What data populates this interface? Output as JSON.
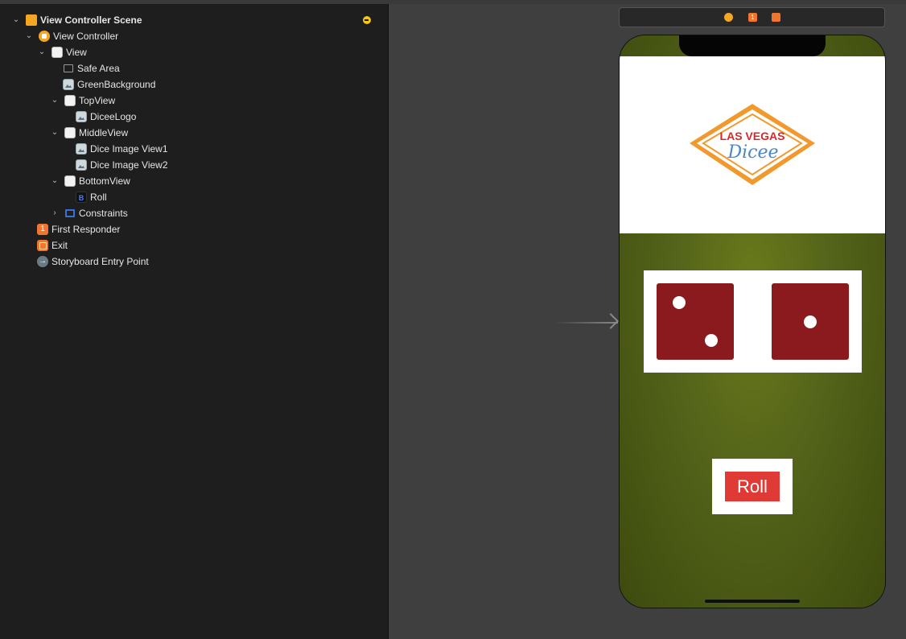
{
  "outline": {
    "items": [
      {
        "label": "View Controller Scene",
        "bold": true,
        "icon": "scene-icon",
        "disclosure": "expanded"
      },
      {
        "label": "View Controller",
        "icon": "view-controller-icon",
        "disclosure": "expanded"
      },
      {
        "label": "View",
        "icon": "view-icon",
        "disclosure": "expanded"
      },
      {
        "label": "Safe Area",
        "icon": "safe-area-icon",
        "disclosure": "none"
      },
      {
        "label": "GreenBackground",
        "icon": "image-view-icon",
        "disclosure": "none"
      },
      {
        "label": "TopView",
        "icon": "view-icon",
        "disclosure": "expanded"
      },
      {
        "label": "DiceeLogo",
        "icon": "image-view-icon",
        "disclosure": "none"
      },
      {
        "label": "MiddleView",
        "icon": "view-icon",
        "disclosure": "expanded"
      },
      {
        "label": "Dice Image View1",
        "icon": "image-view-icon",
        "disclosure": "none"
      },
      {
        "label": "Dice Image View2",
        "icon": "image-view-icon",
        "disclosure": "none"
      },
      {
        "label": "BottomView",
        "icon": "view-icon",
        "disclosure": "expanded"
      },
      {
        "label": "Roll",
        "icon": "button-icon",
        "icon_glyph": "B",
        "disclosure": "none"
      },
      {
        "label": "Constraints",
        "icon": "constraints-icon",
        "disclosure": "collapsed"
      },
      {
        "label": "First Responder",
        "icon": "first-responder-icon",
        "icon_glyph": "1",
        "disclosure": "none"
      },
      {
        "label": "Exit",
        "icon": "exit-icon",
        "disclosure": "none"
      },
      {
        "label": "Storyboard Entry Point",
        "icon": "entry-point-icon",
        "icon_glyph": "→",
        "disclosure": "none"
      }
    ],
    "warning_icon": "warning-icon"
  },
  "document_bar": {
    "icons": [
      "view-controller-icon",
      "first-responder-icon",
      "exit-icon"
    ],
    "first_responder_glyph": "1"
  },
  "scene": {
    "logo": {
      "line1": "LAS VEGAS",
      "line2": "Dicee"
    },
    "dice": [
      {
        "name": "dice-image-view1",
        "value": 2
      },
      {
        "name": "dice-image-view2",
        "value": 1
      }
    ],
    "roll_label": "Roll"
  },
  "colors": {
    "outline_bg": "#1e1e1e",
    "canvas_bg": "#3f3f3f",
    "accent_orange": "#f5a623",
    "warning_yellow": "#f5c518",
    "die_red": "#8b1a1e",
    "roll_button": "#e03a36",
    "green_background": "#55651a"
  }
}
